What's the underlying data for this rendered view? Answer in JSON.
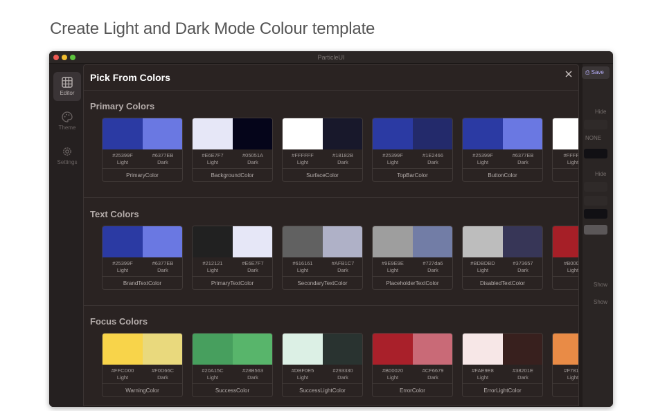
{
  "heading": "Create Light and Dark Mode Colour template",
  "window": {
    "title": "ParticleUI"
  },
  "sidebar": {
    "items": [
      {
        "label": "Editor"
      },
      {
        "label": "Theme"
      },
      {
        "label": "Settings"
      }
    ]
  },
  "right_panel": {
    "save_label": "Save",
    "hide_1": "Hide",
    "none_value": "NONE",
    "hide_2": "Hide",
    "show_1": "Show",
    "show_2": "Show"
  },
  "dialog": {
    "title": "Pick From Colors",
    "sections": [
      {
        "title": "Primary Colors",
        "cards": [
          {
            "name": "PrimaryColor",
            "light_hex": "#25399F",
            "dark_hex": "#6377EB",
            "light_label": "Light",
            "dark_label": "Dark"
          },
          {
            "name": "BackgroundColor",
            "light_hex": "#E6E7F7",
            "dark_hex": "#05051A",
            "light_label": "Light",
            "dark_label": "Dark"
          },
          {
            "name": "SurfaceColor",
            "light_hex": "#FFFFFF",
            "dark_hex": "#18182B",
            "light_label": "Light",
            "dark_label": "Dark"
          },
          {
            "name": "TopBarColor",
            "light_hex": "#25399F",
            "dark_hex": "#1E2466",
            "light_label": "Light",
            "dark_label": "Dark"
          },
          {
            "name": "ButtonColor",
            "light_hex": "#25399F",
            "dark_hex": "#6377EB",
            "light_label": "Light",
            "dark_label": "Dark"
          },
          {
            "name": "Bo",
            "light_hex": "#FFFFF",
            "dark_hex": "",
            "light_label": "Light",
            "dark_label": ""
          }
        ]
      },
      {
        "title": "Text Colors",
        "cards": [
          {
            "name": "BrandTextColor",
            "light_hex": "#25399F",
            "dark_hex": "#6377EB",
            "light_label": "Light",
            "dark_label": "Dark"
          },
          {
            "name": "PrimaryTextColor",
            "light_hex": "#212121",
            "dark_hex": "#E6E7F7",
            "light_label": "Light",
            "dark_label": "Dark"
          },
          {
            "name": "SecondaryTextColor",
            "light_hex": "#616161",
            "dark_hex": "#AFB1C7",
            "light_label": "Light",
            "dark_label": "Dark"
          },
          {
            "name": "PlaceholderTextColor",
            "light_hex": "#9E9E9E",
            "dark_hex": "#727da6",
            "light_label": "Light",
            "dark_label": "Dark"
          },
          {
            "name": "DisabledTextColor",
            "light_hex": "#BDBDBD",
            "dark_hex": "#373657",
            "light_label": "Light",
            "dark_label": "Dark"
          },
          {
            "name": "E",
            "light_hex": "#B0002",
            "dark_hex": "",
            "light_label": "Light",
            "dark_label": ""
          }
        ]
      },
      {
        "title": "Focus Colors",
        "cards": [
          {
            "name": "WarningColor",
            "light_hex": "#FFCD00",
            "dark_hex": "#F0D66C",
            "light_label": "Light",
            "dark_label": "Dark"
          },
          {
            "name": "SuccessColor",
            "light_hex": "#20A15C",
            "dark_hex": "#28B563",
            "light_label": "Light",
            "dark_label": "Dark"
          },
          {
            "name": "SuccessLightColor",
            "light_hex": "#DBF0E5",
            "dark_hex": "#293330",
            "light_label": "Light",
            "dark_label": "Dark"
          },
          {
            "name": "ErrorColor",
            "light_hex": "#B00020",
            "dark_hex": "#CF6679",
            "light_label": "Light",
            "dark_label": "Dark"
          },
          {
            "name": "ErrorLightColor",
            "light_hex": "#FAE9E8",
            "dark_hex": "#38201E",
            "light_label": "Light",
            "dark_label": "Dark"
          },
          {
            "name": "H",
            "light_hex": "#F7812",
            "dark_hex": "",
            "light_label": "Light",
            "dark_label": ""
          }
        ]
      }
    ]
  },
  "swatch_colors": [
    [
      [
        "#2b3aa3",
        "#6a78e2"
      ],
      [
        "#e6e7f7",
        "#05051a"
      ],
      [
        "#ffffff",
        "#18182b"
      ],
      [
        "#2b3aa3",
        "#232a6b"
      ],
      [
        "#2b3aa3",
        "#6a78e2"
      ],
      [
        "#ffffff",
        ""
      ]
    ],
    [
      [
        "#2b3aa3",
        "#6a78e2"
      ],
      [
        "#212121",
        "#e6e7f7"
      ],
      [
        "#616161",
        "#afb1c7"
      ],
      [
        "#9e9e9e",
        "#727da6"
      ],
      [
        "#bdbdbd",
        "#373657"
      ],
      [
        "#a61f27",
        ""
      ]
    ],
    [
      [
        "#f8d44a",
        "#e9d97d"
      ],
      [
        "#479f5e",
        "#58b56b"
      ],
      [
        "#dcf0e5",
        "#293330"
      ],
      [
        "#a9202a",
        "#c96a77"
      ],
      [
        "#f7e7e7",
        "#38201e"
      ],
      [
        "#e98b46",
        ""
      ]
    ]
  ]
}
